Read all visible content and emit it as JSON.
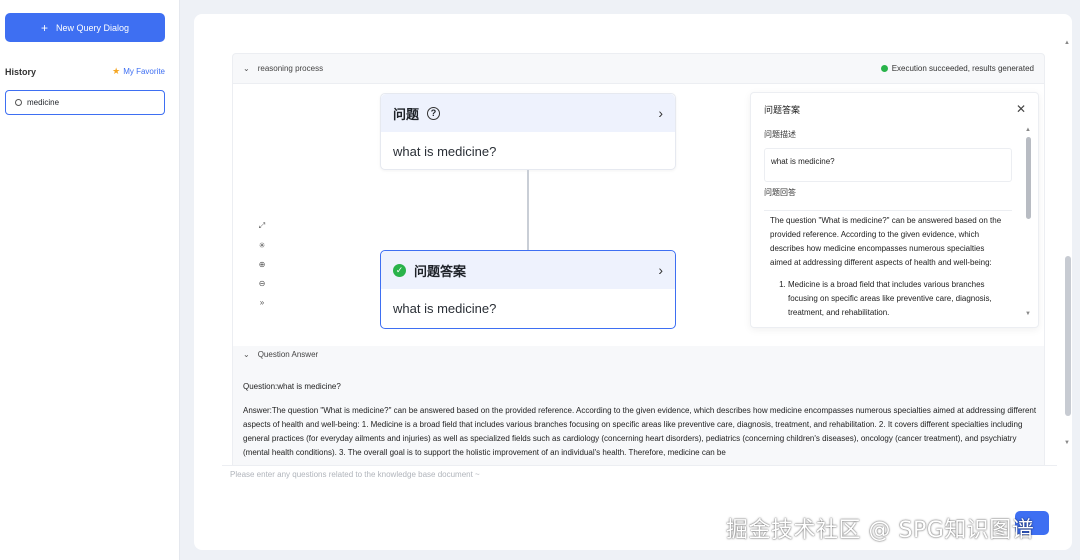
{
  "sidebar": {
    "new_query_label": "New Query Dialog",
    "history_label": "History",
    "favorite_label": "My Favorite",
    "history_items": [
      {
        "label": "medicine"
      }
    ]
  },
  "reasoning": {
    "header_label": "reasoning process",
    "status_text": "Execution succeeded, results generated",
    "status_color": "#29b34a",
    "question_node": {
      "title": "问题",
      "text": "what is medicine?"
    },
    "answer_node": {
      "title": "问题答案",
      "text": "what is medicine?"
    }
  },
  "detail_panel": {
    "title": "问题答案",
    "desc_label": "问题描述",
    "desc_value": "what is medicine?",
    "answer_label": "问题回答",
    "answer_intro": "The question \"What is medicine?\" can be answered based on the provided reference. According to the given evidence, which describes how medicine encompasses numerous specialties aimed at addressing different aspects of health and well-being:",
    "answer_item_1": "Medicine is a broad field that includes various branches focusing on specific areas like preventive care, diagnosis, treatment, and rehabilitation."
  },
  "qa_section": {
    "header_label": "Question Answer",
    "question_line": "Question:what is medicine?",
    "answer_text": "Answer:The question \"What is medicine?\" can be answered based on the provided reference. According to the given evidence, which describes how medicine encompasses numerous specialties aimed at addressing different aspects of health and well-being: 1. Medicine is a broad field that includes various branches focusing on specific areas like preventive care, diagnosis, treatment, and rehabilitation. 2. It covers different specialties including general practices (for everyday ailments and injuries) as well as specialized fields such as cardiology (concerning heart disorders), pediatrics (concerning children's diseases), oncology (cancer treatment), and psychiatry (mental health conditions). 3. The overall goal is to support the holistic improvement of an individual's health. Therefore, medicine can be"
  },
  "input": {
    "placeholder": "Please enter any questions related to the knowledge base document ~"
  },
  "watermark": "掘金技术社区 @ SPG知识图谱",
  "colors": {
    "accent": "#3e6ff2",
    "success": "#29b34a"
  }
}
